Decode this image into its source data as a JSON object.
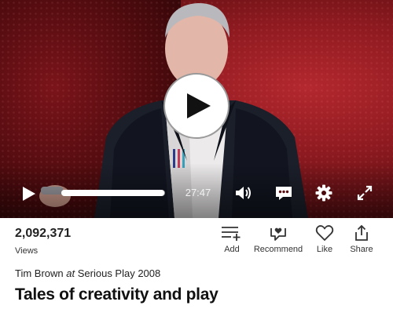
{
  "player": {
    "current_time": "27:47",
    "progress": 0.99,
    "colors": {
      "background_red": "#8e1a20",
      "control_white": "#ffffff"
    },
    "icons": {
      "big_play": "play-icon",
      "play": "play-icon",
      "volume": "volume-icon",
      "captions": "captions-icon",
      "settings": "gear-icon",
      "fullscreen": "fullscreen-icon"
    }
  },
  "stats": {
    "views_count": "2,092,371",
    "views_label": "Views"
  },
  "actions": [
    {
      "label": "Add",
      "icon": "add-to-list-icon"
    },
    {
      "label": "Recommend",
      "icon": "recommend-icon"
    },
    {
      "label": "Like",
      "icon": "heart-icon"
    },
    {
      "label": "Share",
      "icon": "share-icon"
    }
  ],
  "byline": {
    "speaker": "Tim Brown",
    "connector": "at",
    "event": "Serious Play 2008"
  },
  "talk": {
    "title": "Tales of creativity and play"
  }
}
